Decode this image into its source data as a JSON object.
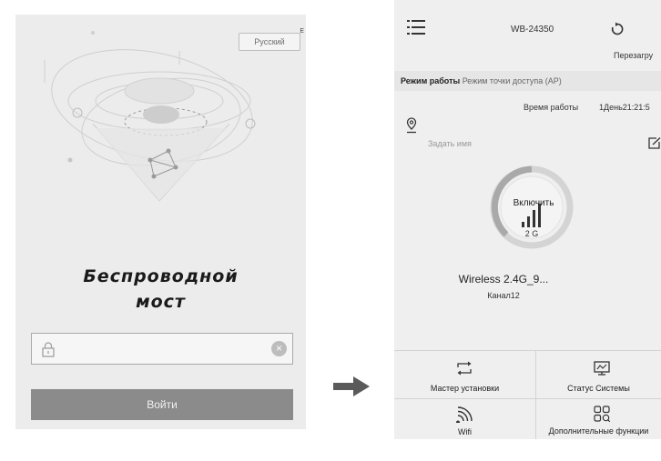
{
  "login": {
    "language": "Русский",
    "language_marker": "E",
    "title_line1": "Беспроводной",
    "title_line2": "мост",
    "password_value": "",
    "password_placeholder": "",
    "login_button": "Войти"
  },
  "status": {
    "device_name": "WB-24350",
    "reboot_label": "Перезагру",
    "mode_key": "Режим работы",
    "mode_value": "Режим точки доступа (AP)",
    "uptime_label": "Время работы",
    "uptime_value": "1День21:21:5",
    "set_name_placeholder": "Задать имя",
    "dial_on_label": "Включить",
    "dial_band": "2 G",
    "ssid": "Wireless 2.4G_9...",
    "channel": "Канал12",
    "tiles": [
      {
        "label": "Мастер установки",
        "icon": "repeat-icon"
      },
      {
        "label": "Статус Системы",
        "icon": "monitor-icon"
      },
      {
        "label": "Wifi",
        "icon": "wifi-icon"
      },
      {
        "label": "Дополнительные функции",
        "icon": "grid-icon"
      }
    ]
  },
  "colors": {
    "screen_bg": "#efefef",
    "login_button_bg": "#8b8b8b",
    "arrow": "#5a5a5a"
  }
}
